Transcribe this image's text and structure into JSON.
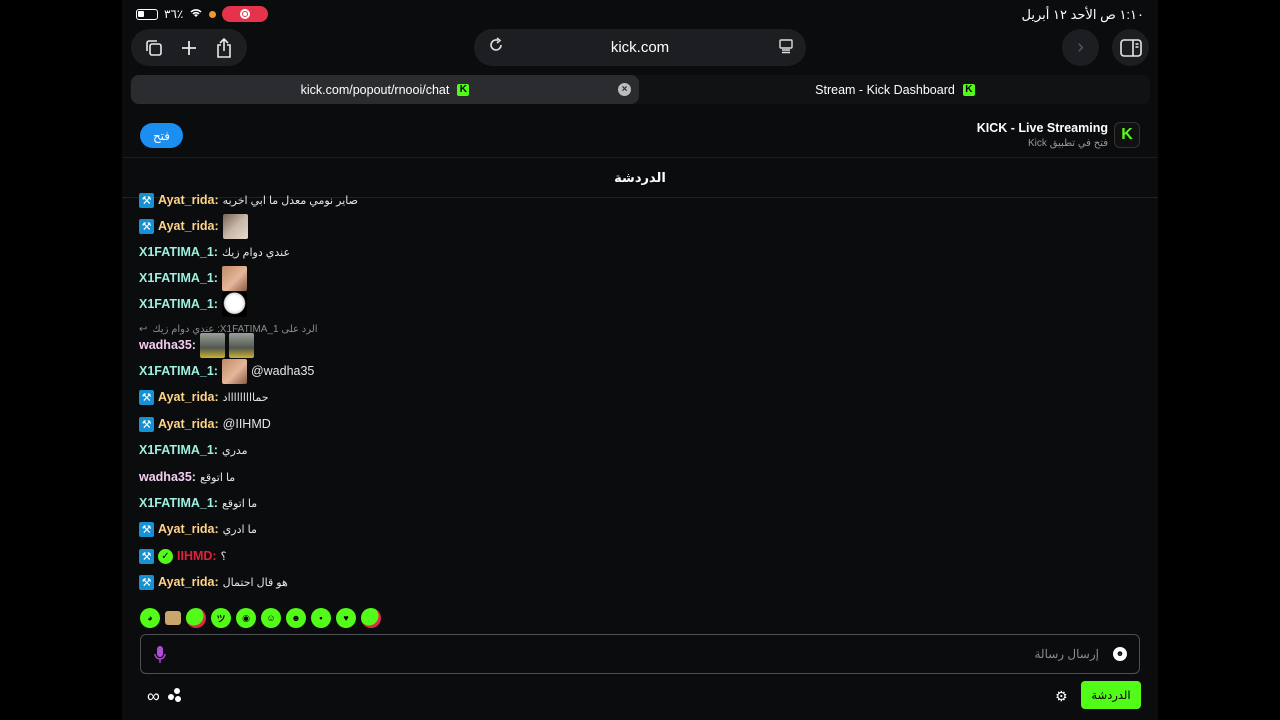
{
  "status_bar": {
    "time": "١:١٠ ص  الأحد ١٢ أبريل",
    "battery": "٣٦٪"
  },
  "browser": {
    "url": "kick.com",
    "tabs": [
      {
        "label": "kick.com/popout/rnooi/chat",
        "active": true
      },
      {
        "label": "Stream - Kick Dashboard",
        "active": false
      }
    ]
  },
  "banner": {
    "open_label": "فتح",
    "app_title": "KICK - Live Streaming",
    "app_subtitle": "فتح في تطبيق Kick"
  },
  "chat": {
    "header": "الدردشة",
    "top_clip": "صاير نومي معدل ما ابي اخربه",
    "messages": [
      {
        "user": "Ayat_rida:",
        "badge": "mod",
        "color": "ayat",
        "text": "",
        "emotes": [
          "em-a"
        ],
        "mention": ""
      },
      {
        "user": "X1FATIMA_1:",
        "badge": "",
        "color": "fatima",
        "text": "عندي دوام زيك",
        "emotes": [],
        "mention": ""
      },
      {
        "user": "X1FATIMA_1:",
        "badge": "",
        "color": "fatima",
        "text": "",
        "emotes": [
          "em-b"
        ],
        "mention": ""
      },
      {
        "user": "X1FATIMA_1:",
        "badge": "",
        "color": "fatima",
        "text": "",
        "emotes": [
          "em-c"
        ],
        "mention": ""
      },
      {
        "user": "wadha35:",
        "badge": "",
        "color": "wadha",
        "text": "",
        "emotes": [
          "em-d",
          "em-d"
        ],
        "mention": ""
      },
      {
        "user": "X1FATIMA_1:",
        "badge": "",
        "color": "fatima",
        "text": "",
        "emotes": [
          "em-b"
        ],
        "mention": "@wadha35"
      },
      {
        "user": "Ayat_rida:",
        "badge": "mod",
        "color": "ayat",
        "text": "حماااااااااد",
        "emotes": [],
        "mention": ""
      },
      {
        "user": "Ayat_rida:",
        "badge": "mod",
        "color": "ayat",
        "text": "",
        "emotes": [],
        "mention": "@IIHMD"
      },
      {
        "user": "X1FATIMA_1:",
        "badge": "",
        "color": "fatima",
        "text": "مدري",
        "emotes": [],
        "mention": ""
      },
      {
        "user": "wadha35:",
        "badge": "",
        "color": "wadha",
        "text": "ما اتوقع",
        "emotes": [],
        "mention": ""
      },
      {
        "user": "X1FATIMA_1:",
        "badge": "",
        "color": "fatima",
        "text": "ما اتوقع",
        "emotes": [],
        "mention": ""
      },
      {
        "user": "Ayat_rida:",
        "badge": "mod",
        "color": "ayat",
        "text": "ما ادري",
        "emotes": [],
        "mention": ""
      },
      {
        "user": "IIHMD:",
        "badge": "mod-ver",
        "color": "ilhmd",
        "text": "؟",
        "emotes": [],
        "mention": ""
      },
      {
        "user": "Ayat_rida:",
        "badge": "mod",
        "color": "ayat",
        "text": "هو قال احتمال",
        "emotes": [],
        "mention": ""
      }
    ],
    "reply_text": "الرد على X1FATIMA_1: عندي دوام زيك",
    "input_placeholder": "إرسال رسالة",
    "send_label": "الدردشة"
  },
  "colors": {
    "kick_green": "#53fc18",
    "mod_blue": "#1790d4",
    "open_blue": "#1b8ef2"
  }
}
